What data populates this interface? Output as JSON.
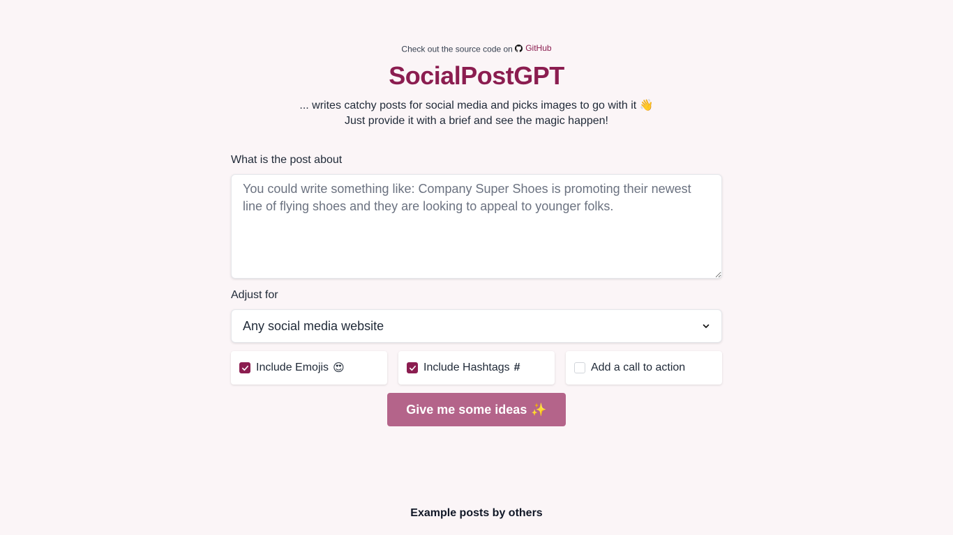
{
  "header": {
    "source_prefix": "Check out the source code on",
    "github_label": "GitHub",
    "title": "SocialPostGPT",
    "subtitle_line1": "... writes catchy posts for social media and picks images to go with it",
    "subtitle_emoji": "👋",
    "subtitle_line2": "Just provide it with a brief and see the magic happen!"
  },
  "form": {
    "about_label": "What is the post about",
    "about_placeholder": "You could write something like: Company Super Shoes is promoting their newest line of flying shoes and they are looking to appeal to younger folks.",
    "adjust_label": "Adjust for",
    "adjust_value": "Any social media website",
    "options": [
      {
        "label": "Include Emojis",
        "suffix": "😍",
        "checked": true
      },
      {
        "label": "Include Hashtags",
        "suffix": "#",
        "checked": true
      },
      {
        "label": "Add a call to action",
        "suffix": "",
        "checked": false
      }
    ],
    "submit_label": "Give me some ideas",
    "submit_emoji": "✨"
  },
  "examples": {
    "heading": "Example posts by others"
  },
  "colors": {
    "brand": "#8b1d50",
    "button": "#b4648a",
    "background": "#fbf5f7"
  },
  "icons": {
    "github": "github-icon",
    "chevron": "chevron-down-icon",
    "check": "check-icon"
  }
}
